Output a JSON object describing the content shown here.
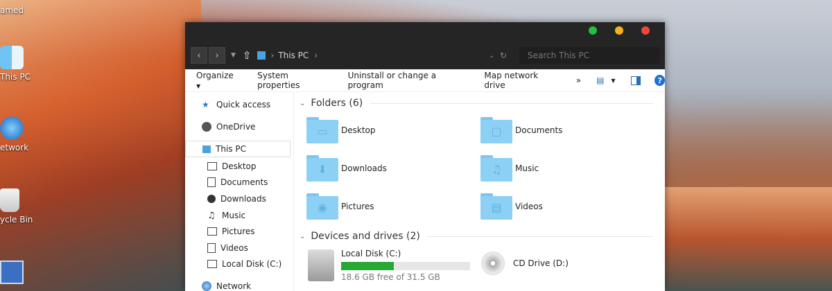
{
  "desktop": {
    "icons": [
      {
        "label": "amed"
      },
      {
        "label": "This PC"
      },
      {
        "label": "etwork"
      },
      {
        "label": "ycle Bin"
      }
    ]
  },
  "window": {
    "breadcrumb": "This PC",
    "search_placeholder": "Search This PC",
    "traffic_colors": [
      "#25c03c",
      "#f5b21f",
      "#f2463b"
    ],
    "toolbar": {
      "organize": "Organize",
      "system_properties": "System properties",
      "uninstall": "Uninstall or change a program",
      "map_drive": "Map network drive",
      "more": "»",
      "help": "?"
    },
    "sidebar": [
      {
        "label": "Quick access",
        "icon": "star-icon"
      },
      {
        "label": "OneDrive",
        "icon": "onedrive-icon"
      },
      {
        "label": "This PC",
        "icon": "pc-icon",
        "selected": true
      },
      {
        "label": "Desktop",
        "icon": "desktop-icon"
      },
      {
        "label": "Documents",
        "icon": "documents-icon"
      },
      {
        "label": "Downloads",
        "icon": "downloads-icon"
      },
      {
        "label": "Music",
        "icon": "music-icon"
      },
      {
        "label": "Pictures",
        "icon": "pictures-icon"
      },
      {
        "label": "Videos",
        "icon": "videos-icon"
      },
      {
        "label": "Local Disk (C:)",
        "icon": "disk-icon"
      },
      {
        "label": "Network",
        "icon": "network-icon"
      }
    ],
    "folders_header": "Folders (6)",
    "folders": [
      {
        "label": "Desktop",
        "glyph": "▭"
      },
      {
        "label": "Documents",
        "glyph": "▢"
      },
      {
        "label": "Downloads",
        "glyph": "⬇"
      },
      {
        "label": "Music",
        "glyph": "♫"
      },
      {
        "label": "Pictures",
        "glyph": "◉"
      },
      {
        "label": "Videos",
        "glyph": "▤"
      }
    ],
    "devices_header": "Devices and drives (2)",
    "drives": [
      {
        "label": "Local Disk (C:)",
        "free_text": "18.6 GB free of 31.5 GB",
        "used_fraction": 0.41
      },
      {
        "label": "CD Drive (D:)"
      }
    ]
  }
}
